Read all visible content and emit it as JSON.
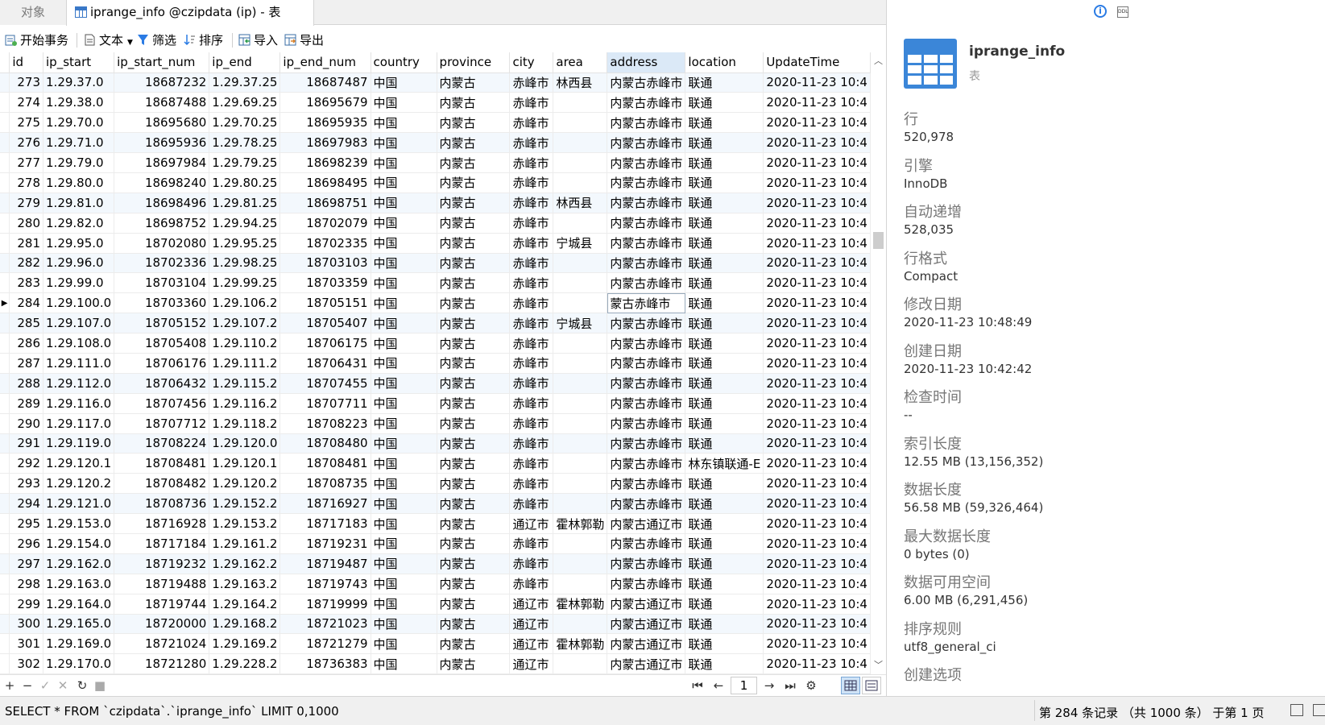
{
  "tabs": [
    {
      "label": "对象"
    },
    {
      "label": "iprange_info @czipdata (ip) - 表"
    }
  ],
  "toolbar": {
    "begin_tx": "开始事务",
    "text": "文本",
    "filter": "筛选",
    "sort": "排序",
    "import": "导入",
    "export": "导出"
  },
  "grid": {
    "columns": [
      "id",
      "ip_start",
      "ip_start_num",
      "ip_end",
      "ip_end_num",
      "country",
      "province",
      "city",
      "area",
      "address",
      "location",
      "UpdateTime"
    ],
    "selected_column": "address",
    "current_row_id": "284",
    "rows": [
      [
        "273",
        "1.29.37.0",
        "18687232",
        "1.29.37.25",
        "18687487",
        "中国",
        "内蒙古",
        "赤峰市",
        "林西县",
        "内蒙古赤峰市",
        "联通",
        "2020-11-23 10:4"
      ],
      [
        "274",
        "1.29.38.0",
        "18687488",
        "1.29.69.25",
        "18695679",
        "中国",
        "内蒙古",
        "赤峰市",
        "",
        "内蒙古赤峰市",
        "联通",
        "2020-11-23 10:4"
      ],
      [
        "275",
        "1.29.70.0",
        "18695680",
        "1.29.70.25",
        "18695935",
        "中国",
        "内蒙古",
        "赤峰市",
        "",
        "内蒙古赤峰市",
        "联通",
        "2020-11-23 10:4"
      ],
      [
        "276",
        "1.29.71.0",
        "18695936",
        "1.29.78.25",
        "18697983",
        "中国",
        "内蒙古",
        "赤峰市",
        "",
        "内蒙古赤峰市",
        "联通",
        "2020-11-23 10:4"
      ],
      [
        "277",
        "1.29.79.0",
        "18697984",
        "1.29.79.25",
        "18698239",
        "中国",
        "内蒙古",
        "赤峰市",
        "",
        "内蒙古赤峰市",
        "联通",
        "2020-11-23 10:4"
      ],
      [
        "278",
        "1.29.80.0",
        "18698240",
        "1.29.80.25",
        "18698495",
        "中国",
        "内蒙古",
        "赤峰市",
        "",
        "内蒙古赤峰市",
        "联通",
        "2020-11-23 10:4"
      ],
      [
        "279",
        "1.29.81.0",
        "18698496",
        "1.29.81.25",
        "18698751",
        "中国",
        "内蒙古",
        "赤峰市",
        "林西县",
        "内蒙古赤峰市",
        "联通",
        "2020-11-23 10:4"
      ],
      [
        "280",
        "1.29.82.0",
        "18698752",
        "1.29.94.25",
        "18702079",
        "中国",
        "内蒙古",
        "赤峰市",
        "",
        "内蒙古赤峰市",
        "联通",
        "2020-11-23 10:4"
      ],
      [
        "281",
        "1.29.95.0",
        "18702080",
        "1.29.95.25",
        "18702335",
        "中国",
        "内蒙古",
        "赤峰市",
        "宁城县",
        "内蒙古赤峰市",
        "联通",
        "2020-11-23 10:4"
      ],
      [
        "282",
        "1.29.96.0",
        "18702336",
        "1.29.98.25",
        "18703103",
        "中国",
        "内蒙古",
        "赤峰市",
        "",
        "内蒙古赤峰市",
        "联通",
        "2020-11-23 10:4"
      ],
      [
        "283",
        "1.29.99.0",
        "18703104",
        "1.29.99.25",
        "18703359",
        "中国",
        "内蒙古",
        "赤峰市",
        "",
        "内蒙古赤峰市",
        "联通",
        "2020-11-23 10:4"
      ],
      [
        "284",
        "1.29.100.0",
        "18703360",
        "1.29.106.2",
        "18705151",
        "中国",
        "内蒙古",
        "赤峰市",
        "",
        "蒙古赤峰市",
        "联通",
        "2020-11-23 10:4"
      ],
      [
        "285",
        "1.29.107.0",
        "18705152",
        "1.29.107.2",
        "18705407",
        "中国",
        "内蒙古",
        "赤峰市",
        "宁城县",
        "内蒙古赤峰市",
        "联通",
        "2020-11-23 10:4"
      ],
      [
        "286",
        "1.29.108.0",
        "18705408",
        "1.29.110.2",
        "18706175",
        "中国",
        "内蒙古",
        "赤峰市",
        "",
        "内蒙古赤峰市",
        "联通",
        "2020-11-23 10:4"
      ],
      [
        "287",
        "1.29.111.0",
        "18706176",
        "1.29.111.2",
        "18706431",
        "中国",
        "内蒙古",
        "赤峰市",
        "",
        "内蒙古赤峰市",
        "联通",
        "2020-11-23 10:4"
      ],
      [
        "288",
        "1.29.112.0",
        "18706432",
        "1.29.115.2",
        "18707455",
        "中国",
        "内蒙古",
        "赤峰市",
        "",
        "内蒙古赤峰市",
        "联通",
        "2020-11-23 10:4"
      ],
      [
        "289",
        "1.29.116.0",
        "18707456",
        "1.29.116.2",
        "18707711",
        "中国",
        "内蒙古",
        "赤峰市",
        "",
        "内蒙古赤峰市",
        "联通",
        "2020-11-23 10:4"
      ],
      [
        "290",
        "1.29.117.0",
        "18707712",
        "1.29.118.2",
        "18708223",
        "中国",
        "内蒙古",
        "赤峰市",
        "",
        "内蒙古赤峰市",
        "联通",
        "2020-11-23 10:4"
      ],
      [
        "291",
        "1.29.119.0",
        "18708224",
        "1.29.120.0",
        "18708480",
        "中国",
        "内蒙古",
        "赤峰市",
        "",
        "内蒙古赤峰市",
        "联通",
        "2020-11-23 10:4"
      ],
      [
        "292",
        "1.29.120.1",
        "18708481",
        "1.29.120.1",
        "18708481",
        "中国",
        "内蒙古",
        "赤峰市",
        "",
        "内蒙古赤峰市",
        "林东镇联通-E",
        "2020-11-23 10:4"
      ],
      [
        "293",
        "1.29.120.2",
        "18708482",
        "1.29.120.2",
        "18708735",
        "中国",
        "内蒙古",
        "赤峰市",
        "",
        "内蒙古赤峰市",
        "联通",
        "2020-11-23 10:4"
      ],
      [
        "294",
        "1.29.121.0",
        "18708736",
        "1.29.152.2",
        "18716927",
        "中国",
        "内蒙古",
        "赤峰市",
        "",
        "内蒙古赤峰市",
        "联通",
        "2020-11-23 10:4"
      ],
      [
        "295",
        "1.29.153.0",
        "18716928",
        "1.29.153.2",
        "18717183",
        "中国",
        "内蒙古",
        "通辽市",
        "霍林郭勒",
        "内蒙古通辽市",
        "联通",
        "2020-11-23 10:4"
      ],
      [
        "296",
        "1.29.154.0",
        "18717184",
        "1.29.161.2",
        "18719231",
        "中国",
        "内蒙古",
        "赤峰市",
        "",
        "内蒙古赤峰市",
        "联通",
        "2020-11-23 10:4"
      ],
      [
        "297",
        "1.29.162.0",
        "18719232",
        "1.29.162.2",
        "18719487",
        "中国",
        "内蒙古",
        "赤峰市",
        "",
        "内蒙古赤峰市",
        "联通",
        "2020-11-23 10:4"
      ],
      [
        "298",
        "1.29.163.0",
        "18719488",
        "1.29.163.2",
        "18719743",
        "中国",
        "内蒙古",
        "赤峰市",
        "",
        "内蒙古赤峰市",
        "联通",
        "2020-11-23 10:4"
      ],
      [
        "299",
        "1.29.164.0",
        "18719744",
        "1.29.164.2",
        "18719999",
        "中国",
        "内蒙古",
        "通辽市",
        "霍林郭勒",
        "内蒙古通辽市",
        "联通",
        "2020-11-23 10:4"
      ],
      [
        "300",
        "1.29.165.0",
        "18720000",
        "1.29.168.2",
        "18721023",
        "中国",
        "内蒙古",
        "通辽市",
        "",
        "内蒙古通辽市",
        "联通",
        "2020-11-23 10:4"
      ],
      [
        "301",
        "1.29.169.0",
        "18721024",
        "1.29.169.2",
        "18721279",
        "中国",
        "内蒙古",
        "通辽市",
        "霍林郭勒",
        "内蒙古通辽市",
        "联通",
        "2020-11-23 10:4"
      ],
      [
        "302",
        "1.29.170.0",
        "18721280",
        "1.29.228.2",
        "18736383",
        "中国",
        "内蒙古",
        "通辽市",
        "",
        "内蒙古通辽市",
        "联通",
        "2020-11-23 10:4"
      ]
    ]
  },
  "nav": {
    "page": "1",
    "add": "+",
    "remove": "−",
    "apply": "✓",
    "discard": "✕",
    "refresh": "↻",
    "stop": "■",
    "first": "⏮",
    "prev": "←",
    "next": "→",
    "last": "⏭",
    "settings": "⚙"
  },
  "status": {
    "sql": "SELECT * FROM `czipdata`.`iprange_info` LIMIT 0,1000",
    "record": "第 284 条记录 （共 1000 条） 于第 1 页"
  },
  "info": {
    "name": "iprange_info",
    "type": "表",
    "ddl_icon": "DDL",
    "properties": [
      {
        "label": "行",
        "value": "520,978"
      },
      {
        "label": "引擎",
        "value": "InnoDB"
      },
      {
        "label": "自动递增",
        "value": "528,035"
      },
      {
        "label": "行格式",
        "value": "Compact"
      },
      {
        "label": "修改日期",
        "value": "2020-11-23 10:48:49"
      },
      {
        "label": "创建日期",
        "value": "2020-11-23 10:42:42"
      },
      {
        "label": "检查时间",
        "value": "--"
      },
      {
        "label": "索引长度",
        "value": "12.55 MB (13,156,352)"
      },
      {
        "label": "数据长度",
        "value": "56.58 MB (59,326,464)"
      },
      {
        "label": "最大数据长度",
        "value": "0 bytes (0)"
      },
      {
        "label": "数据可用空间",
        "value": "6.00 MB (6,291,456)"
      },
      {
        "label": "排序规则",
        "value": "utf8_general_ci"
      },
      {
        "label": "创建选项",
        "value": ""
      }
    ]
  },
  "colors": {
    "accent": "#3b86d8",
    "selected_header": "#dbe9f7",
    "alt_row": "#f3f8fd"
  }
}
